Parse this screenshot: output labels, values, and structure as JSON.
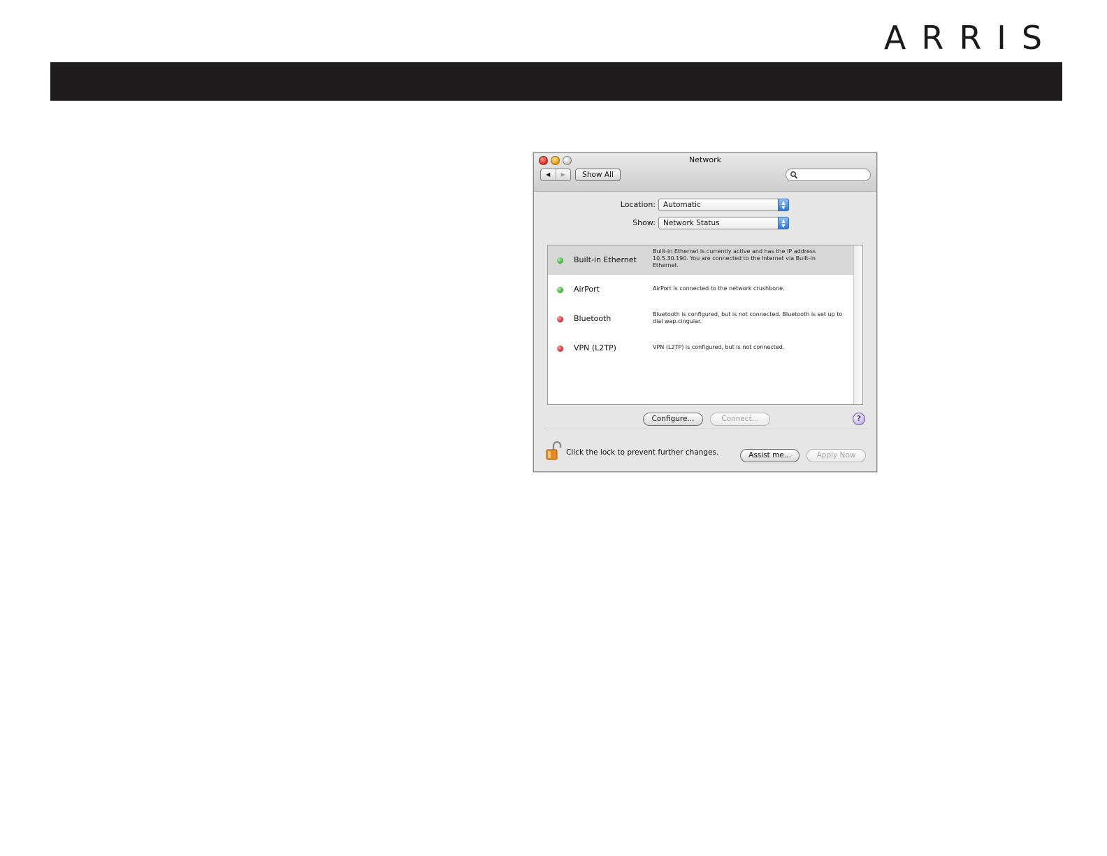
{
  "brand": {
    "logo_text": "ARRIS"
  },
  "window": {
    "title": "Network",
    "toolbar": {
      "back_arrow": "◀",
      "forward_arrow": "▶",
      "show_all": "Show All",
      "search_placeholder": ""
    },
    "location": {
      "label": "Location:",
      "value": "Automatic"
    },
    "show": {
      "label": "Show:",
      "value": "Network Status"
    },
    "services": [
      {
        "name": "Built-in Ethernet",
        "status": "green",
        "selected": true,
        "description": "Built-in Ethernet is currently active and has the IP address 10.5.30.190. You are connected to the Internet via Built-in Ethernet."
      },
      {
        "name": "AirPort",
        "status": "green",
        "selected": false,
        "description": "AirPort is connected to the network crushbone."
      },
      {
        "name": "Bluetooth",
        "status": "red",
        "selected": false,
        "description": "Bluetooth is configured, but is not connected. Bluetooth is set up to dial wap.cingular."
      },
      {
        "name": "VPN (L2TP)",
        "status": "red",
        "selected": false,
        "description": "VPN (L2TP) is configured, but is not connected."
      }
    ],
    "buttons": {
      "configure": "Configure...",
      "connect": "Connect...",
      "help": "?",
      "assist": "Assist me...",
      "apply": "Apply Now"
    },
    "lock_text": "Click the lock to prevent further changes."
  },
  "colors": {
    "header_bar": "#1e1c1c",
    "status_green": "#2ea52a",
    "status_red": "#d11b1b",
    "selected_row": "#d7d7d7"
  }
}
